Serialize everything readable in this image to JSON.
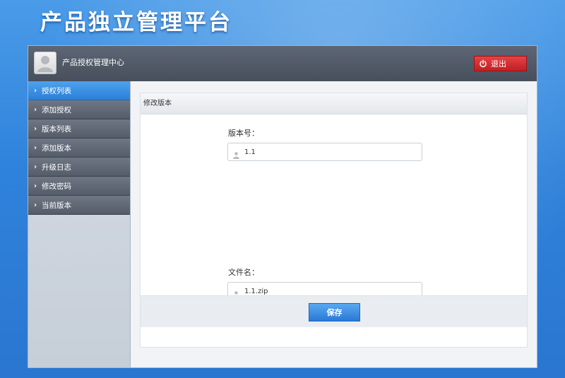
{
  "app": {
    "title": "产品独立管理平台"
  },
  "topbar": {
    "title": "产品授权管理中心",
    "logout_label": "退出"
  },
  "sidebar": {
    "items": [
      {
        "label": "授权列表",
        "active": true
      },
      {
        "label": "添加授权",
        "active": false
      },
      {
        "label": "版本列表",
        "active": false
      },
      {
        "label": "添加版本",
        "active": false
      },
      {
        "label": "升级日志",
        "active": false
      },
      {
        "label": "修改密码",
        "active": false
      },
      {
        "label": "当前版本",
        "active": false
      }
    ]
  },
  "form": {
    "header": "修改版本",
    "version_label": "版本号：",
    "version_value": "1.1",
    "filename_label": "文件名：",
    "filename_value": "1.1.zip",
    "save_label": "保存"
  },
  "colors": {
    "background": "#2f82db",
    "active_item": "#3b8fe2",
    "logout": "#d3292d",
    "save": "#3a8ae0"
  },
  "icons": {
    "avatar": "user-avatar-icon",
    "logout": "power-icon",
    "chevron": "chevron-right-icon",
    "input": "user-icon"
  }
}
